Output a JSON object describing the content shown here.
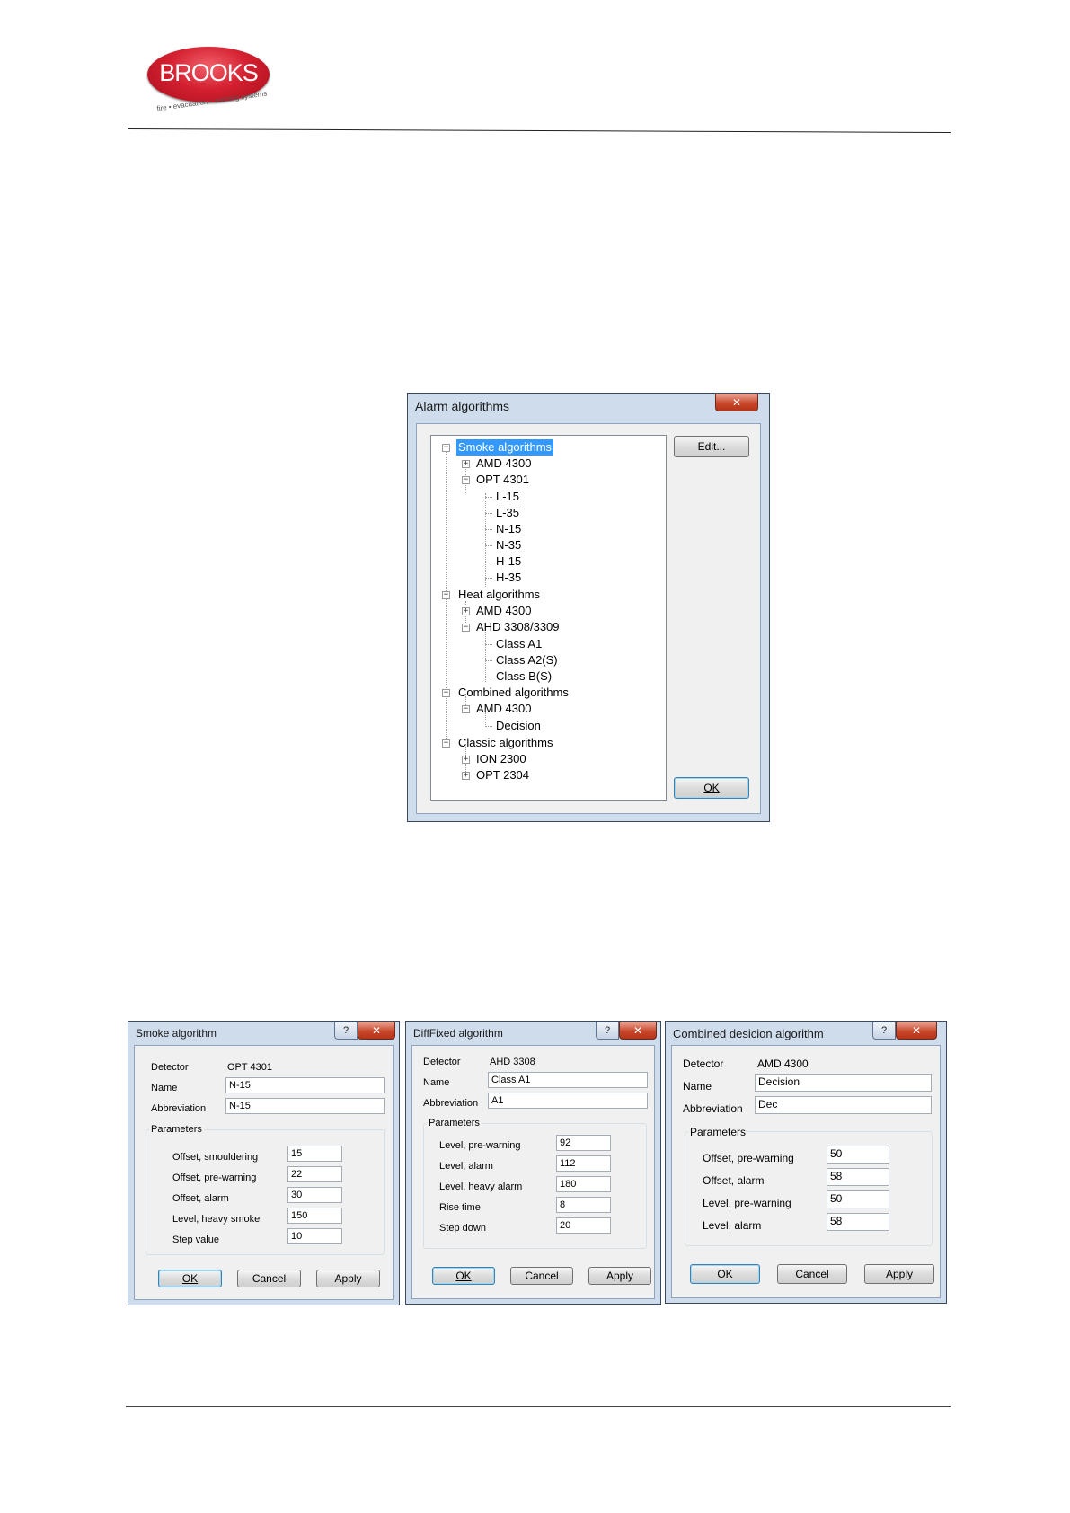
{
  "brand": {
    "logo_text": "BROOKS",
    "tagline": "fire • evacuation • warning systems"
  },
  "alarm": {
    "title": "Alarm algorithms",
    "close": "✕",
    "edit_label": "Edit...",
    "ok_label": "OK",
    "tree": [
      "Smoke algorithms",
      "AMD 4300",
      "OPT 4301",
      "L-15",
      "L-35",
      "N-15",
      "N-35",
      "H-15",
      "H-35",
      "Heat algorithms",
      "AMD 4300",
      "AHD 3308/3309",
      "Class A1",
      "Class A2(S)",
      "Class B(S)",
      "Combined algorithms",
      "AMD 4300",
      "Decision",
      "Classic algorithms",
      "ION 2300",
      "OPT 2304"
    ]
  },
  "smoke": {
    "title": "Smoke algorithm",
    "help": "?",
    "close": "✕",
    "detector_label": "Detector",
    "detector_value": "OPT 4301",
    "name_label": "Name",
    "name_value": "N-15",
    "abbr_label": "Abbreviation",
    "abbr_value": "N-15",
    "params_title": "Parameters",
    "params": [
      {
        "label": "Offset, smouldering",
        "value": "15"
      },
      {
        "label": "Offset, pre-warning",
        "value": "22"
      },
      {
        "label": "Offset, alarm",
        "value": "30"
      },
      {
        "label": "Level, heavy smoke",
        "value": "150"
      },
      {
        "label": "Step value",
        "value": "10"
      }
    ],
    "ok": "OK",
    "cancel": "Cancel",
    "apply": "Apply"
  },
  "diff": {
    "title": "DiffFixed algorithm",
    "help": "?",
    "close": "✕",
    "detector_label": "Detector",
    "detector_value": "AHD 3308",
    "name_label": "Name",
    "name_value": "Class A1",
    "abbr_label": "Abbreviation",
    "abbr_value": "A1",
    "params_title": "Parameters",
    "params": [
      {
        "label": "Level, pre-warning",
        "value": "92"
      },
      {
        "label": "Level, alarm",
        "value": "112"
      },
      {
        "label": "Level, heavy alarm",
        "value": "180"
      },
      {
        "label": "Rise time",
        "value": "8"
      },
      {
        "label": "Step down",
        "value": "20"
      }
    ],
    "ok": "OK",
    "cancel": "Cancel",
    "apply": "Apply"
  },
  "comb": {
    "title": "Combined desicion algorithm",
    "help": "?",
    "close": "✕",
    "detector_label": "Detector",
    "detector_value": "AMD 4300",
    "name_label": "Name",
    "name_value": "Decision",
    "abbr_label": "Abbreviation",
    "abbr_value": "Dec",
    "params_title": "Parameters",
    "params": [
      {
        "label": "Offset, pre-warning",
        "value": "50"
      },
      {
        "label": "Offset, alarm",
        "value": "58"
      },
      {
        "label": "Level, pre-warning",
        "value": "50"
      },
      {
        "label": "Level, alarm",
        "value": "58"
      }
    ],
    "ok": "OK",
    "cancel": "Cancel",
    "apply": "Apply"
  }
}
